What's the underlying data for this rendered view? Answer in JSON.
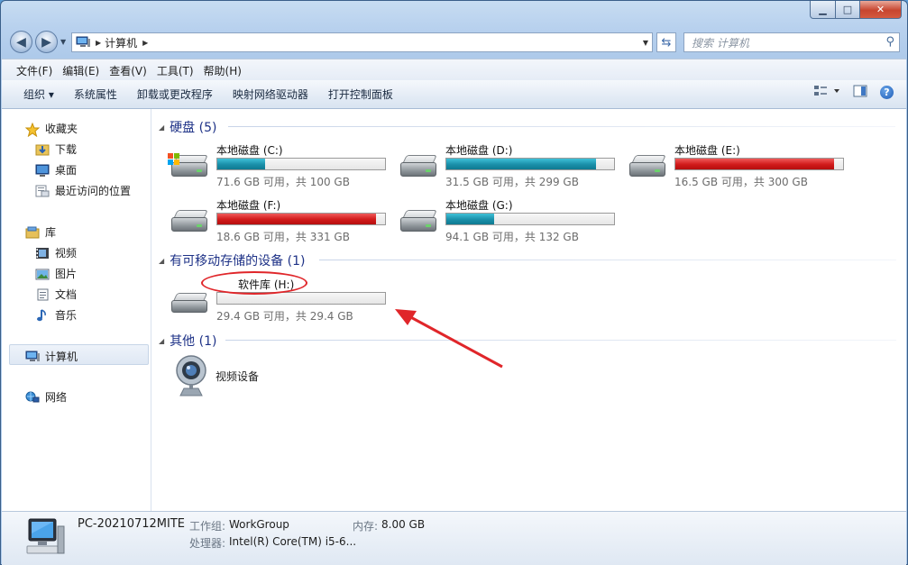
{
  "window": {
    "controls": {
      "minimize": "▁",
      "maximize": "□",
      "close": "✕"
    }
  },
  "nav": {
    "back_icon": "back-arrow-icon",
    "forward_icon": "forward-arrow-icon",
    "address_segment": "计算机",
    "search_placeholder": "搜索 计算机"
  },
  "menu": [
    "文件(F)",
    "编辑(E)",
    "查看(V)",
    "工具(T)",
    "帮助(H)"
  ],
  "commands": [
    "组织 ▾",
    "系统属性",
    "卸载或更改程序",
    "映射网络驱动器",
    "打开控制面板"
  ],
  "sidebar": {
    "favorites": {
      "label": "收藏夹",
      "items": [
        "下载",
        "桌面",
        "最近访问的位置"
      ]
    },
    "libraries": {
      "label": "库",
      "items": [
        "视频",
        "图片",
        "文档",
        "音乐"
      ]
    },
    "computer": "计算机",
    "network": "网络"
  },
  "groups": {
    "hdd": "硬盘 (5)",
    "removable": "有可移动存储的设备 (1)",
    "other": "其他 (1)"
  },
  "drives": [
    {
      "name": "本地磁盘 (C:)",
      "info": "71.6 GB 可用，共 100 GB",
      "used_fraction": 0.284,
      "color": "#1a8fa9",
      "system": true
    },
    {
      "name": "本地磁盘 (D:)",
      "info": "31.5 GB 可用，共 299 GB",
      "used_fraction": 0.895,
      "color": "#1a8fa9",
      "system": false
    },
    {
      "name": "本地磁盘 (E:)",
      "info": "16.5 GB 可用，共 300 GB",
      "used_fraction": 0.945,
      "color": "#d11a1a",
      "system": false
    },
    {
      "name": "本地磁盘 (F:)",
      "info": "18.6 GB 可用，共 331 GB",
      "used_fraction": 0.944,
      "color": "#d11a1a",
      "system": false
    },
    {
      "name": "本地磁盘 (G:)",
      "info": "94.1 GB 可用，共 132 GB",
      "used_fraction": 0.287,
      "color": "#1a8fa9",
      "system": false
    }
  ],
  "removable_drive": {
    "name": "软件库 (H:)",
    "info": "29.4 GB 可用，共 29.4 GB",
    "used_fraction": 0.0
  },
  "other_device": {
    "name": "视频设备"
  },
  "details": {
    "pc_name": "PC-20210712MITE",
    "workgroup_label": "工作组:",
    "workgroup": "WorkGroup",
    "memory_label": "内存:",
    "memory": "8.00 GB",
    "cpu_label": "处理器:",
    "cpu": "Intel(R) Core(TM) i5-6..."
  },
  "annotation_color": "#e0262a"
}
